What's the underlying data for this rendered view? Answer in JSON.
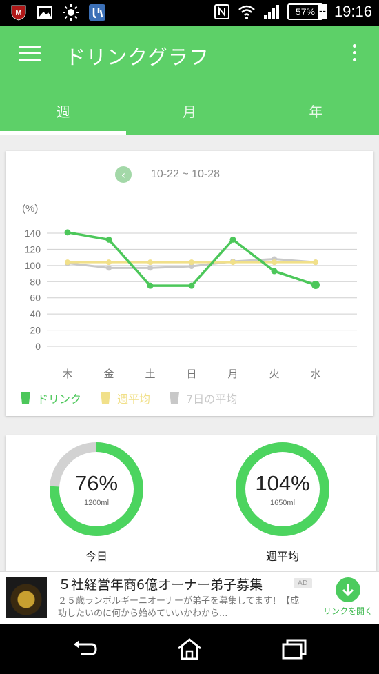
{
  "status_bar": {
    "time": "19:16",
    "battery": "57%",
    "battery_plus": "+",
    "left_icons": [
      "mcafee-icon",
      "image-icon",
      "brightness-icon",
      "notification-app-icon"
    ],
    "right_icons": [
      "nfc-icon",
      "wifi-icon",
      "signal-icon",
      "battery-icon"
    ]
  },
  "app_bar": {
    "title": "ドリンクグラフ",
    "tabs": [
      {
        "label": "週",
        "active": true
      },
      {
        "label": "月",
        "active": false
      },
      {
        "label": "年",
        "active": false
      }
    ]
  },
  "chart_card": {
    "prev_icon": "chevron-left-icon",
    "date_range": "10-22 ~ 10-28",
    "legend": [
      {
        "label": "ドリンク",
        "color": "#4cc75a"
      },
      {
        "label": "週平均",
        "color": "#f1e08a"
      },
      {
        "label": "7日の平均",
        "color": "#c8c8c8"
      }
    ]
  },
  "chart_data": {
    "type": "line",
    "ylabel": "(%)",
    "ylim": [
      0,
      140
    ],
    "yticks": [
      0,
      20,
      40,
      60,
      80,
      100,
      120,
      140
    ],
    "categories": [
      "木",
      "金",
      "土",
      "日",
      "月",
      "火",
      "水"
    ],
    "series": [
      {
        "name": "ドリンク",
        "color": "#4cc75a",
        "values": [
          141,
          132,
          75,
          75,
          132,
          93,
          76
        ]
      },
      {
        "name": "週平均",
        "color": "#f1e08a",
        "values": [
          104,
          104,
          104,
          104,
          104,
          104,
          104
        ]
      },
      {
        "name": "7日の平均",
        "color": "#c8c8c8",
        "values": [
          103,
          97,
          97,
          99,
          105,
          108,
          104
        ]
      }
    ],
    "grid": true
  },
  "gauges": [
    {
      "percent": "76%",
      "volume": "1200ml",
      "label": "今日",
      "fraction": 0.76
    },
    {
      "percent": "104%",
      "volume": "1650ml",
      "label": "週平均",
      "fraction": 1.0
    }
  ],
  "gauge_colors": {
    "fill": "#4cd45f",
    "track": "#d2d2d2"
  },
  "ad": {
    "title": "５社経営年商6億オーナー弟子募集",
    "badge": "AD",
    "description": "２５歳ランボルギーニオーナーが弟子を募集してます！【成功したいのに何から始めていいかわから...",
    "cta_label": "リンクを開く"
  },
  "nav_bar": {
    "buttons": [
      "back-icon",
      "home-icon",
      "recent-apps-icon"
    ]
  }
}
